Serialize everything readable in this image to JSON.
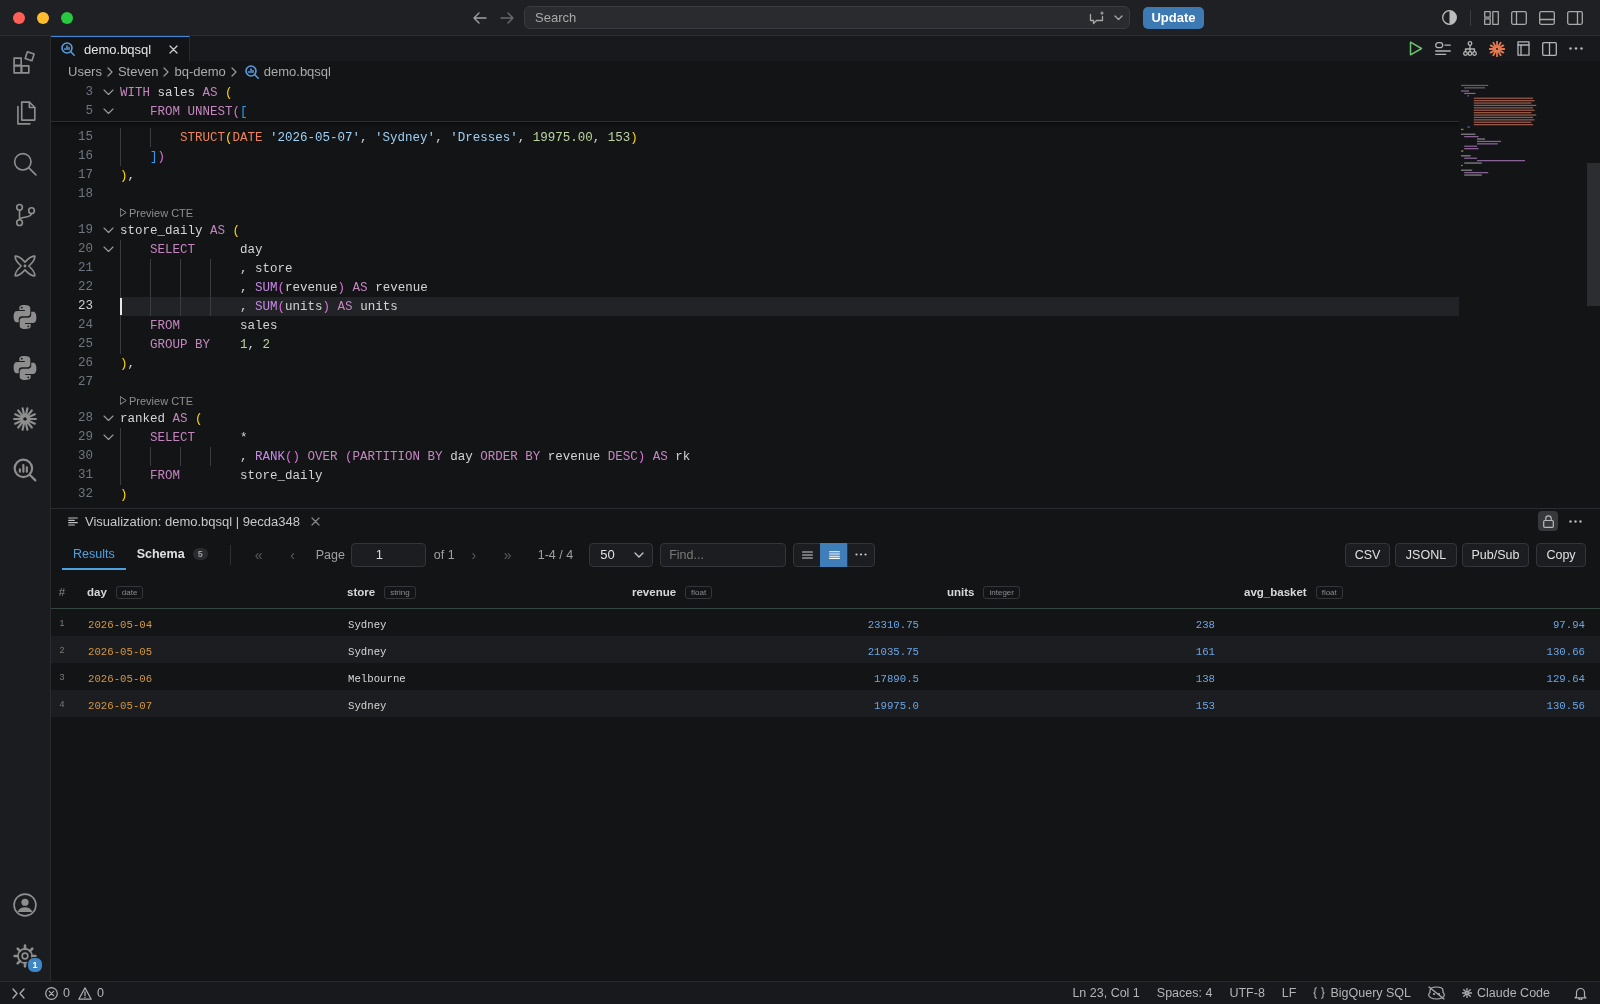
{
  "window": {
    "search": {
      "placeholder": "Search"
    },
    "update_button": "Update"
  },
  "activity_bar": {
    "settings_badge": "1"
  },
  "editor": {
    "tabs": [
      {
        "label": "demo.bqsql",
        "selected": true
      }
    ],
    "breadcrumb": [
      "Users",
      "Steven",
      "bq-demo",
      "demo.bqsql"
    ],
    "sticky_lines": [
      {
        "kind": "code",
        "number": "3",
        "foldable": true,
        "tokens": [
          {
            "text": "WITH",
            "kind": "keyword"
          },
          {
            "text": " sales ",
            "kind": "plain"
          },
          {
            "text": "AS",
            "kind": "keyword"
          },
          {
            "text": " (",
            "kind": "bracket1"
          }
        ]
      },
      {
        "kind": "code",
        "number": "5",
        "foldable": true,
        "tokens": [
          {
            "text": "    FROM UNNEST",
            "kind": "keyword"
          },
          {
            "text": "(",
            "kind": "bracket2"
          },
          {
            "text": "[",
            "kind": "bracket3"
          }
        ]
      }
    ],
    "lines": [
      {
        "kind": "code",
        "number": "15",
        "foldable": false,
        "current": false,
        "tokens": [
          {
            "text": "        STRUCT",
            "kind": "type"
          },
          {
            "text": "(",
            "kind": "bracket1"
          },
          {
            "text": "DATE",
            "kind": "type"
          },
          {
            "text": " '2026-05-07'",
            "kind": "string"
          },
          {
            "text": ", ",
            "kind": "plain"
          },
          {
            "text": "'Sydney'",
            "kind": "string"
          },
          {
            "text": ", ",
            "kind": "plain"
          },
          {
            "text": "'Dresses'",
            "kind": "string"
          },
          {
            "text": ", ",
            "kind": "plain"
          },
          {
            "text": "19975.00",
            "kind": "number"
          },
          {
            "text": ", ",
            "kind": "plain"
          },
          {
            "text": "153",
            "kind": "number"
          },
          {
            "text": ")",
            "kind": "bracket1"
          }
        ]
      },
      {
        "kind": "code",
        "number": "16",
        "foldable": false,
        "current": false,
        "tokens": [
          {
            "text": "    ]",
            "kind": "bracket3"
          },
          {
            "text": ")",
            "kind": "bracket2"
          }
        ]
      },
      {
        "kind": "code",
        "number": "17",
        "foldable": false,
        "current": false,
        "tokens": [
          {
            "text": ")",
            "kind": "bracket1"
          },
          {
            "text": ",",
            "kind": "plain"
          }
        ]
      },
      {
        "kind": "code",
        "number": "18",
        "foldable": false,
        "current": false
      },
      {
        "kind": "lens",
        "text": "Preview CTE"
      },
      {
        "kind": "code",
        "number": "19",
        "foldable": true,
        "current": false,
        "tokens": [
          {
            "text": "store_daily ",
            "kind": "plain"
          },
          {
            "text": "AS",
            "kind": "keyword"
          },
          {
            "text": " (",
            "kind": "bracket1"
          }
        ]
      },
      {
        "kind": "code",
        "number": "20",
        "foldable": true,
        "current": false,
        "tokens": [
          {
            "text": "    SELECT",
            "kind": "keyword"
          },
          {
            "text": "      day",
            "kind": "plain"
          }
        ]
      },
      {
        "kind": "code",
        "number": "21",
        "foldable": false,
        "current": false,
        "tokens": [
          {
            "text": "                , store",
            "kind": "plain"
          }
        ]
      },
      {
        "kind": "code",
        "number": "22",
        "foldable": false,
        "current": false,
        "tokens": [
          {
            "text": "                , ",
            "kind": "plain"
          },
          {
            "text": "SUM",
            "kind": "function"
          },
          {
            "text": "(",
            "kind": "bracket2"
          },
          {
            "text": "revenue",
            "kind": "plain"
          },
          {
            "text": ") ",
            "kind": "bracket2"
          },
          {
            "text": "AS",
            "kind": "keyword"
          },
          {
            "text": " revenue",
            "kind": "plain"
          }
        ]
      },
      {
        "kind": "code",
        "number": "23",
        "foldable": false,
        "current": true,
        "tokens": [
          {
            "text": "                , ",
            "kind": "plain"
          },
          {
            "text": "SUM",
            "kind": "function"
          },
          {
            "text": "(",
            "kind": "bracket2"
          },
          {
            "text": "units",
            "kind": "plain"
          },
          {
            "text": ") ",
            "kind": "bracket2"
          },
          {
            "text": "AS",
            "kind": "keyword"
          },
          {
            "text": " units",
            "kind": "plain"
          }
        ]
      },
      {
        "kind": "code",
        "number": "24",
        "foldable": false,
        "current": false,
        "tokens": [
          {
            "text": "    FROM",
            "kind": "keyword"
          },
          {
            "text": "        sales",
            "kind": "plain"
          }
        ]
      },
      {
        "kind": "code",
        "number": "25",
        "foldable": false,
        "current": false,
        "tokens": [
          {
            "text": "    GROUP BY",
            "kind": "keyword"
          },
          {
            "text": "    1",
            "kind": "number"
          },
          {
            "text": ", ",
            "kind": "plain"
          },
          {
            "text": "2",
            "kind": "number"
          }
        ]
      },
      {
        "kind": "code",
        "number": "26",
        "foldable": false,
        "current": false,
        "tokens": [
          {
            "text": ")",
            "kind": "bracket1"
          },
          {
            "text": ",",
            "kind": "plain"
          }
        ]
      },
      {
        "kind": "code",
        "number": "27",
        "foldable": false,
        "current": false
      },
      {
        "kind": "lens",
        "text": "Preview CTE"
      },
      {
        "kind": "code",
        "number": "28",
        "foldable": true,
        "current": false,
        "tokens": [
          {
            "text": "ranked ",
            "kind": "plain"
          },
          {
            "text": "AS",
            "kind": "keyword"
          },
          {
            "text": " (",
            "kind": "bracket1"
          }
        ]
      },
      {
        "kind": "code",
        "number": "29",
        "foldable": true,
        "current": false,
        "tokens": [
          {
            "text": "    SELECT",
            "kind": "keyword"
          },
          {
            "text": "      *",
            "kind": "plain"
          }
        ]
      },
      {
        "kind": "code",
        "number": "30",
        "foldable": false,
        "current": false,
        "tokens": [
          {
            "text": "                , ",
            "kind": "plain"
          },
          {
            "text": "RANK",
            "kind": "function"
          },
          {
            "text": "()",
            "kind": "bracket2"
          },
          {
            "text": " OVER",
            "kind": "keyword"
          },
          {
            "text": " (",
            "kind": "bracket2"
          },
          {
            "text": "PARTITION BY",
            "kind": "keyword"
          },
          {
            "text": " day ",
            "kind": "plain"
          },
          {
            "text": "ORDER BY",
            "kind": "keyword"
          },
          {
            "text": " revenue ",
            "kind": "plain"
          },
          {
            "text": "DESC",
            "kind": "keyword"
          },
          {
            "text": ") ",
            "kind": "bracket2"
          },
          {
            "text": "AS",
            "kind": "keyword"
          },
          {
            "text": " rk",
            "kind": "plain"
          }
        ]
      },
      {
        "kind": "code",
        "number": "31",
        "foldable": false,
        "current": false,
        "tokens": [
          {
            "text": "    FROM",
            "kind": "keyword"
          },
          {
            "text": "        store_daily",
            "kind": "plain"
          }
        ]
      },
      {
        "kind": "code",
        "number": "32",
        "foldable": false,
        "current": false,
        "tokens": [
          {
            "text": ")",
            "kind": "bracket1"
          }
        ]
      }
    ]
  },
  "panel": {
    "title": "Visualization: demo.bqsql | 9ecda348",
    "tabs": [
      {
        "label": "Results",
        "selected": true
      },
      {
        "label": "Schema",
        "count": "5",
        "selected": false
      }
    ],
    "pagination": {
      "back_buttons": [
        {
          "label": "«",
          "disabled": true
        },
        {
          "label": "‹",
          "disabled": true
        }
      ],
      "page_label": "Page",
      "page_value": "1",
      "page_total": "of 1",
      "forward_buttons": [
        {
          "label": "›",
          "disabled": true
        },
        {
          "label": "»",
          "disabled": true
        }
      ],
      "range": "1-4 / 4"
    },
    "page_size": "50",
    "find": {
      "placeholder": "Find..."
    },
    "view_modes": [
      {
        "kind": "comfortable",
        "selected": false
      },
      {
        "kind": "compact",
        "selected": true
      }
    ],
    "export_buttons": [
      "CSV",
      "JSONL",
      "Pub/Sub",
      "Copy"
    ],
    "table": {
      "columns": [
        {
          "name": "#"
        },
        {
          "name": "day",
          "type": "date"
        },
        {
          "name": "store",
          "type": "string"
        },
        {
          "name": "revenue",
          "type": "float"
        },
        {
          "name": "units",
          "type": "integer"
        },
        {
          "name": "avg_basket",
          "type": "float"
        }
      ],
      "rows": [
        {
          "cells": [
            "1",
            "2026-05-04",
            "Sydney",
            "23310.75",
            "238",
            "97.94"
          ]
        },
        {
          "cells": [
            "2",
            "2026-05-05",
            "Sydney",
            "21035.75",
            "161",
            "130.66"
          ]
        },
        {
          "cells": [
            "3",
            "2026-05-06",
            "Melbourne",
            "17890.5",
            "138",
            "129.64"
          ]
        },
        {
          "cells": [
            "4",
            "2026-05-07",
            "Sydney",
            "19975.0",
            "153",
            "130.56"
          ]
        }
      ]
    }
  },
  "status_bar": {
    "errors": "0",
    "warnings": "0",
    "items": [
      "Ln 23, Col 1",
      "Spaces: 4",
      "UTF-8",
      "LF"
    ],
    "language": "BigQuery SQL",
    "assistant": "Claude Code"
  }
}
